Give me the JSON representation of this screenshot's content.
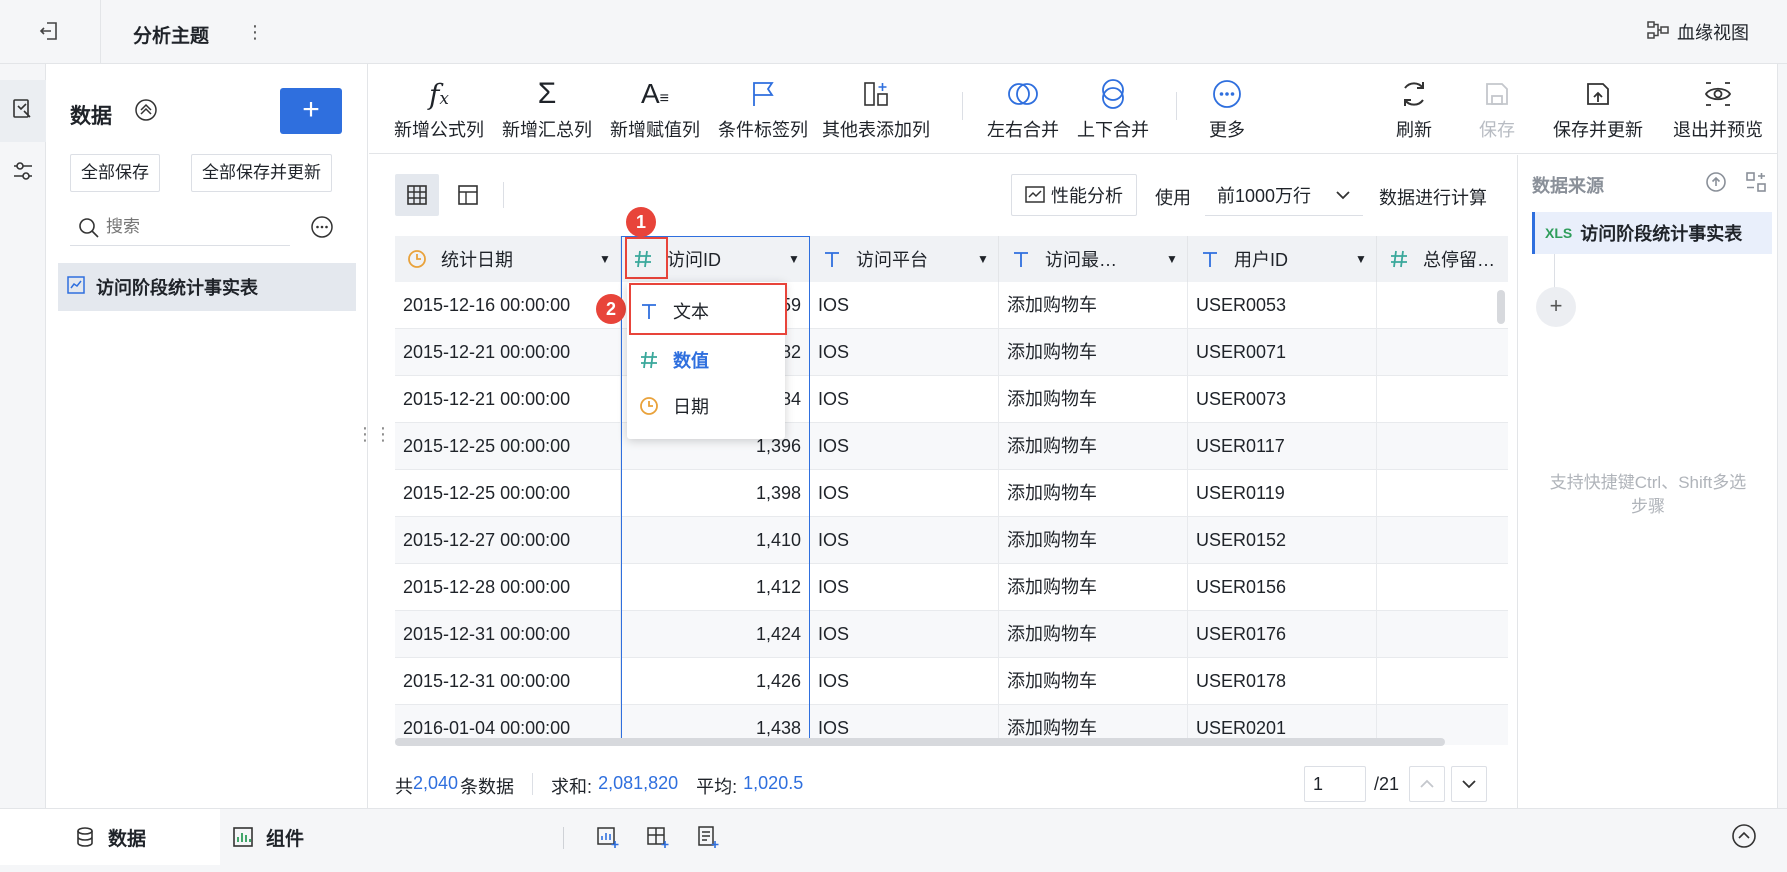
{
  "header": {
    "title": "分析主题",
    "lineage_label": "血缘视图"
  },
  "data_panel": {
    "title": "数据",
    "add_label": "+",
    "save_all": "全部保存",
    "save_all_update": "全部保存并更新",
    "search_placeholder": "搜索",
    "table_name": "访问阶段统计事实表"
  },
  "toolbar": {
    "items": [
      {
        "label": "新增公式列",
        "icon": "formula-icon"
      },
      {
        "label": "新增汇总列",
        "icon": "sigma-icon"
      },
      {
        "label": "新增赋值列",
        "icon": "assign-icon"
      },
      {
        "label": "条件标签列",
        "icon": "flag-icon"
      },
      {
        "label": "其他表添加列",
        "icon": "add-column-icon"
      },
      {
        "label": "左右合并",
        "icon": "merge-lr-icon"
      },
      {
        "label": "上下合并",
        "icon": "merge-ud-icon"
      },
      {
        "label": "更多",
        "icon": "more-icon"
      },
      {
        "label": "刷新",
        "icon": "refresh-icon"
      },
      {
        "label": "保存",
        "icon": "save-icon"
      },
      {
        "label": "保存并更新",
        "icon": "save-update-icon"
      },
      {
        "label": "退出并预览",
        "icon": "preview-icon"
      }
    ]
  },
  "subbar": {
    "perf_label": "性能分析",
    "use_label": "使用",
    "rows_value": "前1000万行",
    "calc_label": "数据进行计算"
  },
  "grid": {
    "columns": [
      {
        "name": "统计日期",
        "type": "date"
      },
      {
        "name": "访问ID",
        "type": "number"
      },
      {
        "name": "访问平台",
        "type": "text"
      },
      {
        "name": "访问最…",
        "type": "text"
      },
      {
        "name": "用户ID",
        "type": "text"
      },
      {
        "name": "总停留…",
        "type": "number"
      }
    ],
    "rows": [
      [
        "2015-12-16 00:00:00",
        "1,359",
        "IOS",
        "添加购物车",
        "USER0053",
        ""
      ],
      [
        "2015-12-21 00:00:00",
        "1,382",
        "IOS",
        "添加购物车",
        "USER0071",
        ""
      ],
      [
        "2015-12-21 00:00:00",
        "1,384",
        "IOS",
        "添加购物车",
        "USER0073",
        ""
      ],
      [
        "2015-12-25 00:00:00",
        "1,396",
        "IOS",
        "添加购物车",
        "USER0117",
        ""
      ],
      [
        "2015-12-25 00:00:00",
        "1,398",
        "IOS",
        "添加购物车",
        "USER0119",
        ""
      ],
      [
        "2015-12-27 00:00:00",
        "1,410",
        "IOS",
        "添加购物车",
        "USER0152",
        ""
      ],
      [
        "2015-12-28 00:00:00",
        "1,412",
        "IOS",
        "添加购物车",
        "USER0156",
        ""
      ],
      [
        "2015-12-31 00:00:00",
        "1,424",
        "IOS",
        "添加购物车",
        "USER0176",
        ""
      ],
      [
        "2015-12-31 00:00:00",
        "1,426",
        "IOS",
        "添加购物车",
        "USER0178",
        ""
      ],
      [
        "2016-01-04 00:00:00",
        "1,438",
        "IOS",
        "添加购物车",
        "USER0201",
        ""
      ]
    ]
  },
  "type_menu": {
    "items": [
      {
        "label": "文本",
        "type": "text"
      },
      {
        "label": "数值",
        "type": "number",
        "selected": true
      },
      {
        "label": "日期",
        "type": "date"
      }
    ]
  },
  "markers": [
    "1",
    "2"
  ],
  "summary": {
    "total_prefix": "共",
    "total_value": "2,040",
    "total_suffix": "条数据",
    "sum_label": "求和:",
    "sum_value": "2,081,820",
    "avg_label": "平均:",
    "avg_value": "1,020.5"
  },
  "pagination": {
    "current": "1",
    "total": "/21"
  },
  "source_panel": {
    "title": "数据来源",
    "item_badge": "XLS",
    "item_name": "访问阶段统计事实表",
    "hint": "支持快捷键Ctrl、Shift多选步骤"
  },
  "bottom_tabs": {
    "data": "数据",
    "components": "组件"
  },
  "colors": {
    "accent": "#2f6fde",
    "marker": "#e8443a",
    "number_type": "#3aa89b",
    "date_type": "#e9a23b",
    "text_type": "#2f6fde"
  }
}
